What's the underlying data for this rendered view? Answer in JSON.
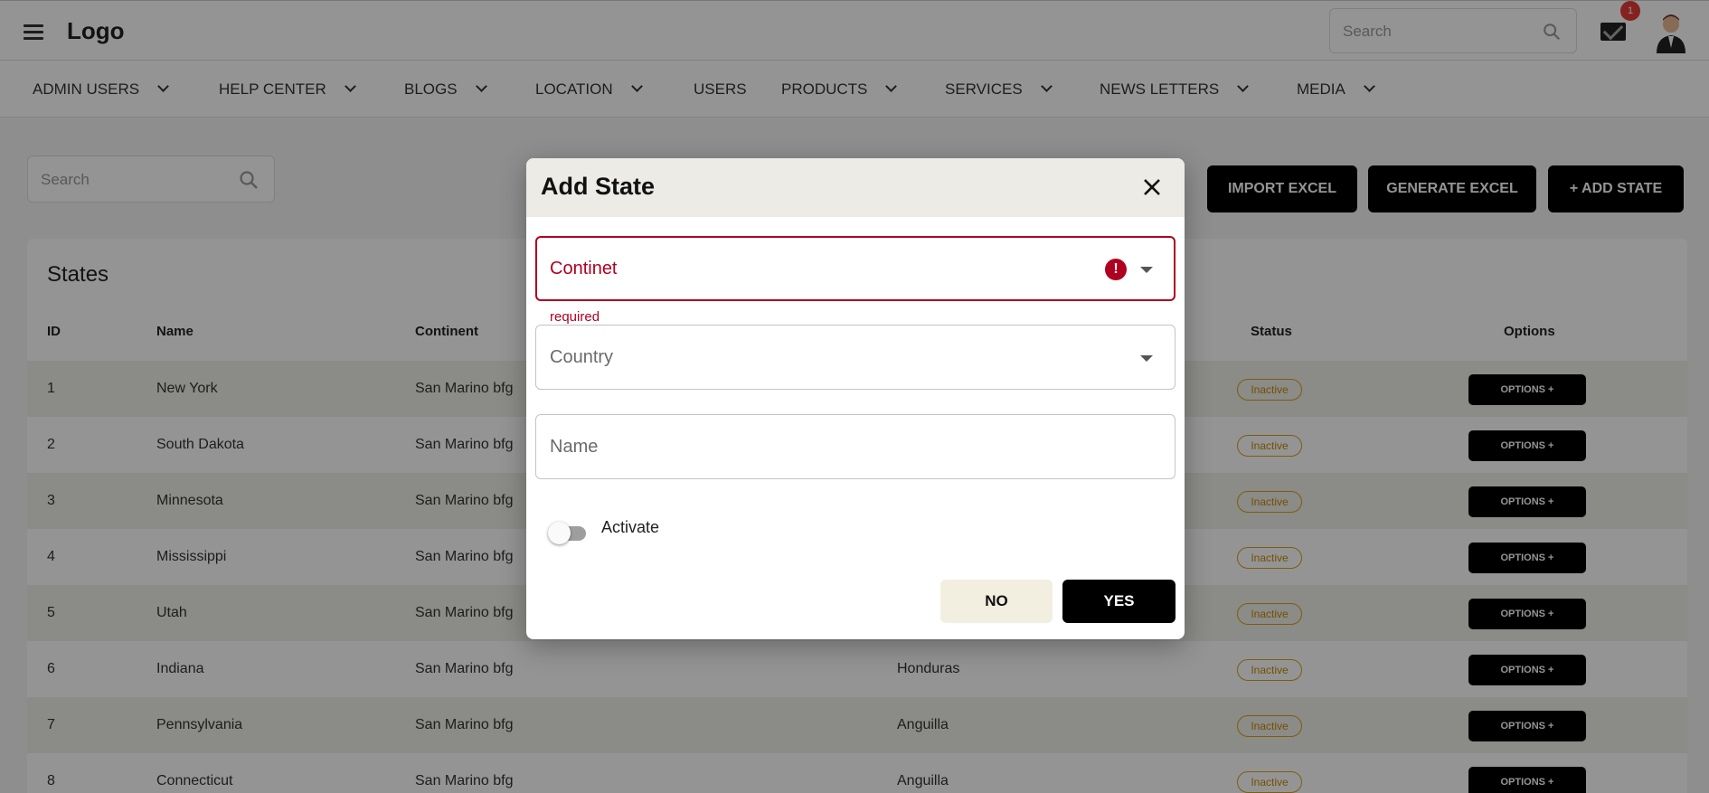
{
  "header": {
    "logo": "Logo",
    "search_placeholder": "Search",
    "notification_count": "1"
  },
  "nav": [
    {
      "label": "ADMIN USERS",
      "dropdown": true
    },
    {
      "label": "HELP CENTER",
      "dropdown": true
    },
    {
      "label": "BLOGS",
      "dropdown": true
    },
    {
      "label": "LOCATION",
      "dropdown": true
    },
    {
      "label": "USERS",
      "dropdown": false
    },
    {
      "label": "PRODUCTS",
      "dropdown": true
    },
    {
      "label": "SERVICES",
      "dropdown": true
    },
    {
      "label": "NEWS LETTERS",
      "dropdown": true
    },
    {
      "label": "MEDIA",
      "dropdown": true
    }
  ],
  "page": {
    "search_placeholder": "Search",
    "actions": [
      "IMPORT EXCEL",
      "GENERATE EXCEL",
      "+ ADD STATE"
    ],
    "table_title": "States",
    "columns": [
      "ID",
      "Name",
      "Continent",
      "Status",
      "Options"
    ],
    "rows": [
      {
        "id": "1",
        "name": "New York",
        "continent": "San Marino bfg",
        "country": "",
        "status": "Inactive"
      },
      {
        "id": "2",
        "name": "South Dakota",
        "continent": "San Marino bfg",
        "country": "",
        "status": "Inactive"
      },
      {
        "id": "3",
        "name": "Minnesota",
        "continent": "San Marino bfg",
        "country": "",
        "status": "Inactive"
      },
      {
        "id": "4",
        "name": "Mississippi",
        "continent": "San Marino bfg",
        "country": "",
        "status": "Inactive"
      },
      {
        "id": "5",
        "name": "Utah",
        "continent": "San Marino bfg",
        "country": "",
        "status": "Inactive"
      },
      {
        "id": "6",
        "name": "Indiana",
        "continent": "San Marino bfg",
        "country": "Honduras",
        "status": "Inactive"
      },
      {
        "id": "7",
        "name": "Pennsylvania",
        "continent": "San Marino bfg",
        "country": "Anguilla",
        "status": "Inactive"
      },
      {
        "id": "8",
        "name": "Connecticut",
        "continent": "San Marino bfg",
        "country": "Anguilla",
        "status": "Inactive"
      }
    ],
    "options_label": "OPTIONS +"
  },
  "dialog": {
    "title": "Add State",
    "continent_label": "Continet",
    "continent_error": "required",
    "country_label": "Country",
    "name_label": "Name",
    "activate_label": "Activate",
    "activate_on": false,
    "no_label": "NO",
    "yes_label": "YES"
  },
  "colors": {
    "error": "#b00020",
    "primary": "#000000",
    "header_bg": "#ecebe6"
  }
}
